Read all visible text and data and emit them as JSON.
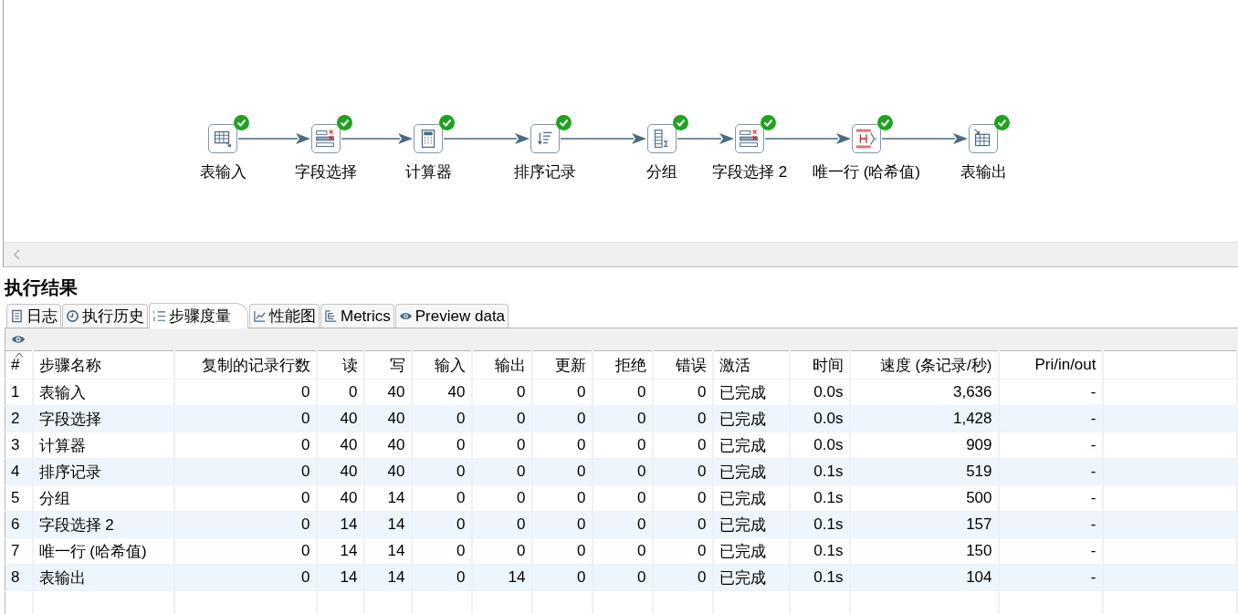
{
  "canvas": {
    "steps": [
      {
        "label": "表输入",
        "kind": "table-input",
        "completed": true
      },
      {
        "label": "字段选择",
        "kind": "select-values",
        "completed": true
      },
      {
        "label": "计算器",
        "kind": "calculator",
        "completed": true
      },
      {
        "label": "排序记录",
        "kind": "sort",
        "completed": true
      },
      {
        "label": "分组",
        "kind": "group-by",
        "completed": true
      },
      {
        "label": "字段选择 2",
        "kind": "select-values",
        "completed": true
      },
      {
        "label": "唯一行 (哈希值)",
        "kind": "unique-hash",
        "completed": true
      },
      {
        "label": "表输出",
        "kind": "table-output",
        "completed": true
      }
    ]
  },
  "results": {
    "title": "执行结果",
    "tabs": [
      {
        "label": "日志",
        "selected": false
      },
      {
        "label": "执行历史",
        "selected": false
      },
      {
        "label": "步骤度量",
        "selected": true
      },
      {
        "label": "性能图",
        "selected": false
      },
      {
        "label": "Metrics",
        "selected": false
      },
      {
        "label": "Preview data",
        "selected": false
      }
    ],
    "table": {
      "columns": [
        "#",
        "步骤名称",
        "复制的记录行数",
        "读",
        "写",
        "输入",
        "输出",
        "更新",
        "拒绝",
        "错误",
        "激活",
        "时间",
        "速度 (条记录/秒)",
        "Pri/in/out"
      ],
      "rows": [
        [
          "1",
          "表输入",
          "0",
          "0",
          "40",
          "40",
          "0",
          "0",
          "0",
          "0",
          "已完成",
          "0.0s",
          "3,636",
          "-"
        ],
        [
          "2",
          "字段选择",
          "0",
          "40",
          "40",
          "0",
          "0",
          "0",
          "0",
          "0",
          "已完成",
          "0.0s",
          "1,428",
          "-"
        ],
        [
          "3",
          "计算器",
          "0",
          "40",
          "40",
          "0",
          "0",
          "0",
          "0",
          "0",
          "已完成",
          "0.0s",
          "909",
          "-"
        ],
        [
          "4",
          "排序记录",
          "0",
          "40",
          "40",
          "0",
          "0",
          "0",
          "0",
          "0",
          "已完成",
          "0.1s",
          "519",
          "-"
        ],
        [
          "5",
          "分组",
          "0",
          "40",
          "14",
          "0",
          "0",
          "0",
          "0",
          "0",
          "已完成",
          "0.1s",
          "500",
          "-"
        ],
        [
          "6",
          "字段选择 2",
          "0",
          "14",
          "14",
          "0",
          "0",
          "0",
          "0",
          "0",
          "已完成",
          "0.1s",
          "157",
          "-"
        ],
        [
          "7",
          "唯一行 (哈希值)",
          "0",
          "14",
          "14",
          "0",
          "0",
          "0",
          "0",
          "0",
          "已完成",
          "0.1s",
          "150",
          "-"
        ],
        [
          "8",
          "表输出",
          "0",
          "14",
          "14",
          "0",
          "14",
          "0",
          "0",
          "0",
          "已完成",
          "0.1s",
          "104",
          "-"
        ]
      ]
    }
  }
}
